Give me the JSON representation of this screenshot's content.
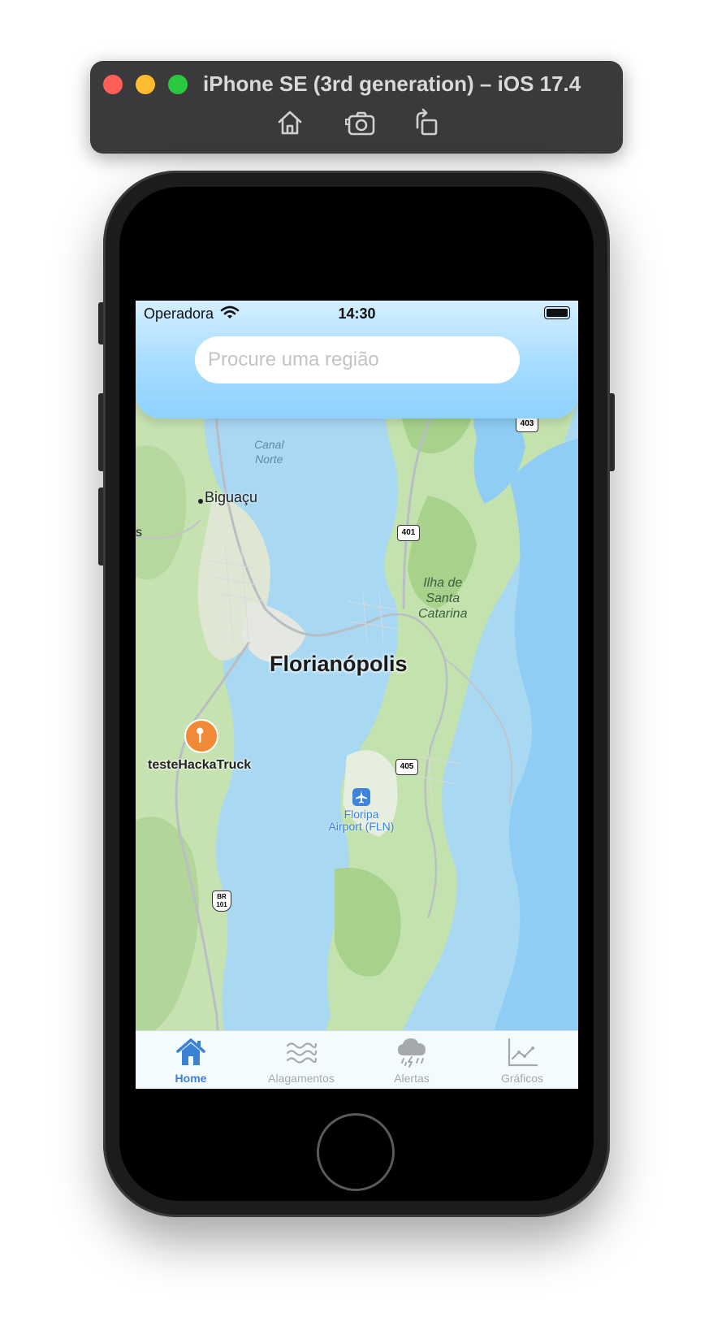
{
  "simulator": {
    "title": "iPhone SE (3rd generation) – iOS 17.4",
    "buttons": [
      "home-icon",
      "screenshot-icon",
      "rotate-icon"
    ]
  },
  "status_bar": {
    "carrier": "Operadora",
    "time": "14:30"
  },
  "search": {
    "placeholder": "Procure uma região",
    "value": ""
  },
  "map": {
    "labels": {
      "canal_norte": [
        "Canal",
        "Norte"
      ],
      "biguacu": "Biguaçu",
      "s_edge": "s",
      "ilha": [
        "Ilha de",
        "Santa",
        "Catarina"
      ],
      "florianopolis": "Florianópolis",
      "airport": [
        "Floripa",
        "Airport (FLN)"
      ]
    },
    "road_shields": [
      "403",
      "401",
      "405",
      "BR",
      "101"
    ],
    "pin_label": "testeHackaTruck"
  },
  "tabs": [
    {
      "label": "Home",
      "icon": "house-icon",
      "active": true
    },
    {
      "label": "Alagamentos",
      "icon": "water-waves-icon",
      "active": false
    },
    {
      "label": "Alertas",
      "icon": "cloud-bolt-rain-icon",
      "active": false
    },
    {
      "label": "Gráficos",
      "icon": "line-chart-icon",
      "active": false
    }
  ],
  "colors": {
    "accent": "#3b82d6",
    "header_top": "#d4efff",
    "header_bottom": "#8fd1ff",
    "water": "#a9d8f3",
    "land": "#c7e3b4",
    "pin": "#f08a36"
  }
}
